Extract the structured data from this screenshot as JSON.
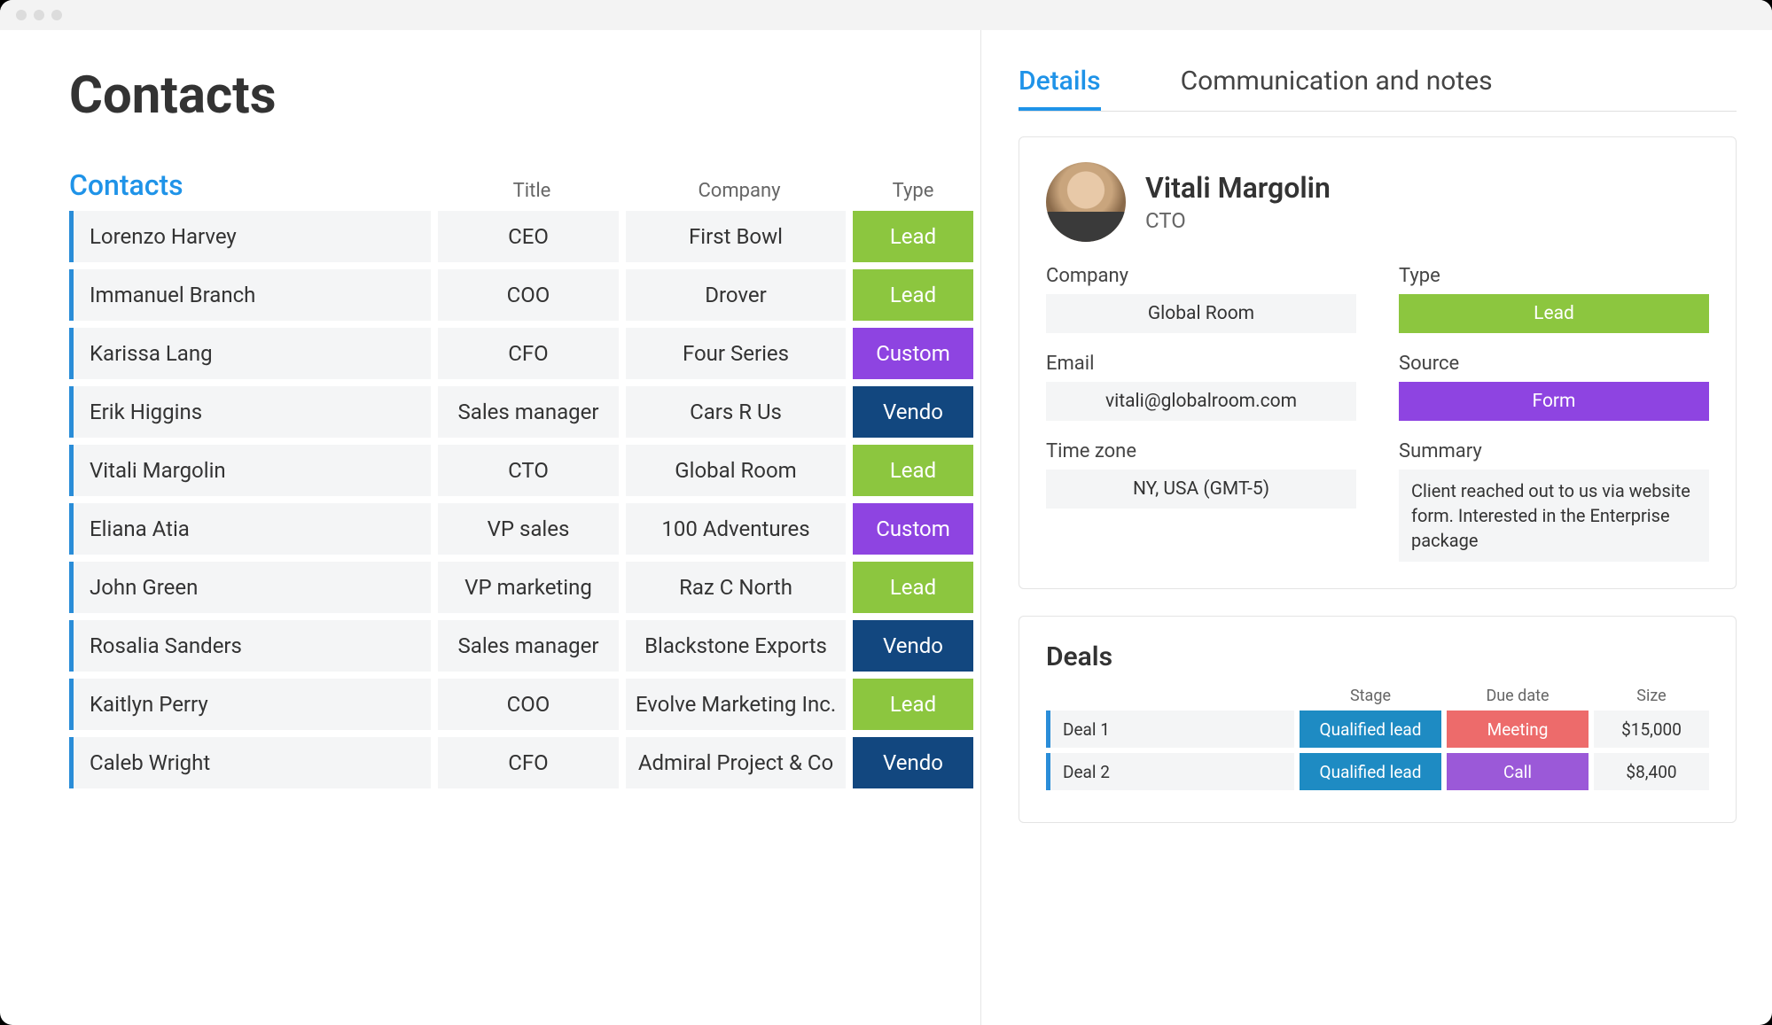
{
  "page": {
    "title": "Contacts"
  },
  "table": {
    "tab_label": "Contacts",
    "headers": {
      "title": "Title",
      "company": "Company",
      "type": "Type"
    },
    "rows": [
      {
        "name": "Lorenzo Harvey",
        "title": "CEO",
        "company": "First Bowl",
        "type": "Lead",
        "type_class": "type-lead"
      },
      {
        "name": "Immanuel Branch",
        "title": "COO",
        "company": "Drover",
        "type": "Lead",
        "type_class": "type-lead"
      },
      {
        "name": "Karissa Lang",
        "title": "CFO",
        "company": "Four Series",
        "type": "Custom",
        "type_class": "type-customer"
      },
      {
        "name": "Erik Higgins",
        "title": "Sales manager",
        "company": "Cars R Us",
        "type": "Vendo",
        "type_class": "type-vendor"
      },
      {
        "name": "Vitali Margolin",
        "title": "CTO",
        "company": "Global Room",
        "type": "Lead",
        "type_class": "type-lead"
      },
      {
        "name": "Eliana Atia",
        "title": "VP sales",
        "company": "100 Adventures",
        "type": "Custom",
        "type_class": "type-customer"
      },
      {
        "name": "John Green",
        "title": "VP marketing",
        "company": "Raz C North",
        "type": "Lead",
        "type_class": "type-lead"
      },
      {
        "name": "Rosalia Sanders",
        "title": "Sales manager",
        "company": "Blackstone Exports",
        "type": "Vendo",
        "type_class": "type-vendor"
      },
      {
        "name": "Kaitlyn Perry",
        "title": "COO",
        "company": "Evolve Marketing Inc.",
        "type": "Lead",
        "type_class": "type-lead"
      },
      {
        "name": "Caleb Wright",
        "title": "CFO",
        "company": "Admiral Project & Co",
        "type": "Vendo",
        "type_class": "type-vendor"
      }
    ]
  },
  "tabs": {
    "details": "Details",
    "comm": "Communication and notes"
  },
  "detail": {
    "name": "Vitali Margolin",
    "title": "CTO",
    "labels": {
      "company": "Company",
      "type": "Type",
      "email": "Email",
      "source": "Source",
      "timezone": "Time zone",
      "summary": "Summary"
    },
    "company": "Global Room",
    "type": "Lead",
    "type_class": "type-lead",
    "email": "vitali@globalroom.com",
    "source": "Form",
    "source_class": "type-customer",
    "timezone": "NY, USA (GMT-5)",
    "summary": "Client reached out to us via website form. Interested in the Enterprise package"
  },
  "deals": {
    "title": "Deals",
    "headers": {
      "stage": "Stage",
      "due": "Due date",
      "size": "Size"
    },
    "rows": [
      {
        "name": "Deal 1",
        "stage": "Qualified lead",
        "due": "Meeting",
        "due_class": "due-meeting",
        "size": "$15,000"
      },
      {
        "name": "Deal 2",
        "stage": "Qualified lead",
        "due": "Call",
        "due_class": "due-call",
        "size": "$8,400"
      }
    ]
  }
}
